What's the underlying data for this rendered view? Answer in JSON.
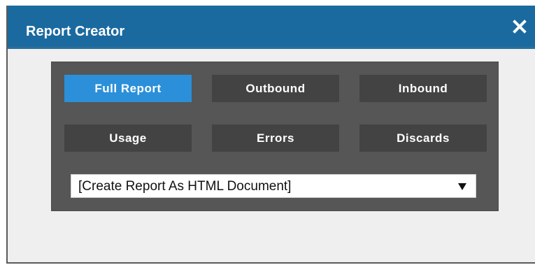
{
  "window": {
    "title": "Report Creator",
    "close_icon": "close-icon"
  },
  "report_buttons": [
    {
      "label": "Full Report",
      "selected": true
    },
    {
      "label": "Outbound",
      "selected": false
    },
    {
      "label": "Inbound",
      "selected": false
    },
    {
      "label": "Usage",
      "selected": false
    },
    {
      "label": "Errors",
      "selected": false
    },
    {
      "label": "Discards",
      "selected": false
    }
  ],
  "format_select": {
    "selected": "[Create Report As HTML Document]",
    "arrow_icon": "dropdown-arrow-icon"
  },
  "colors": {
    "titlebar": "#1a6aa0",
    "panel": "#565656",
    "button": "#434343",
    "button_selected": "#2b90d9",
    "dialog_background": "#efefef"
  }
}
